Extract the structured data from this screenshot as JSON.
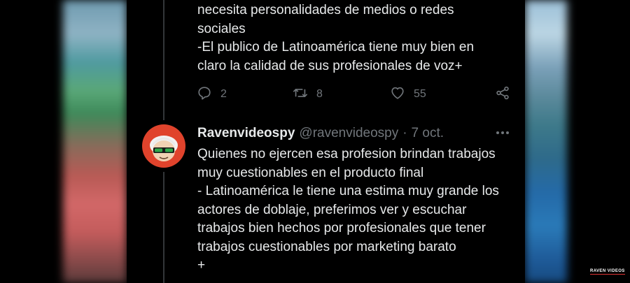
{
  "tweet_top": {
    "text": "necesita personalidades de medios o redes\nsociales\n-El publico de Latinoamérica tiene muy bien en\nclaro la calidad de sus profesionales de voz+",
    "replies": "2",
    "retweets": "8",
    "likes": "55"
  },
  "reply": {
    "display_name": "Ravenvideospy",
    "handle": "@ravenvideospy",
    "separator": "·",
    "time": "7 oct.",
    "text": "Quienes no ejercen esa profesion brindan trabajos\nmuy cuestionables en el producto final\n- Latinoamérica le tiene una estima muy grande los\nactores de doblaje, preferimos ver y escuchar\ntrabajos bien hechos por profesionales que tener\ntrabajos cuestionables por marketing barato\n+"
  },
  "watermark": "RAVEN VIDEOS",
  "icons": {
    "reply": "reply-icon",
    "retweet": "retweet-icon",
    "like": "heart-icon",
    "share": "share-icon",
    "more": "more-icon"
  },
  "colors": {
    "background": "#000000",
    "text": "#e7e9ea",
    "muted": "#71767b",
    "avatar": "#e0432c"
  }
}
